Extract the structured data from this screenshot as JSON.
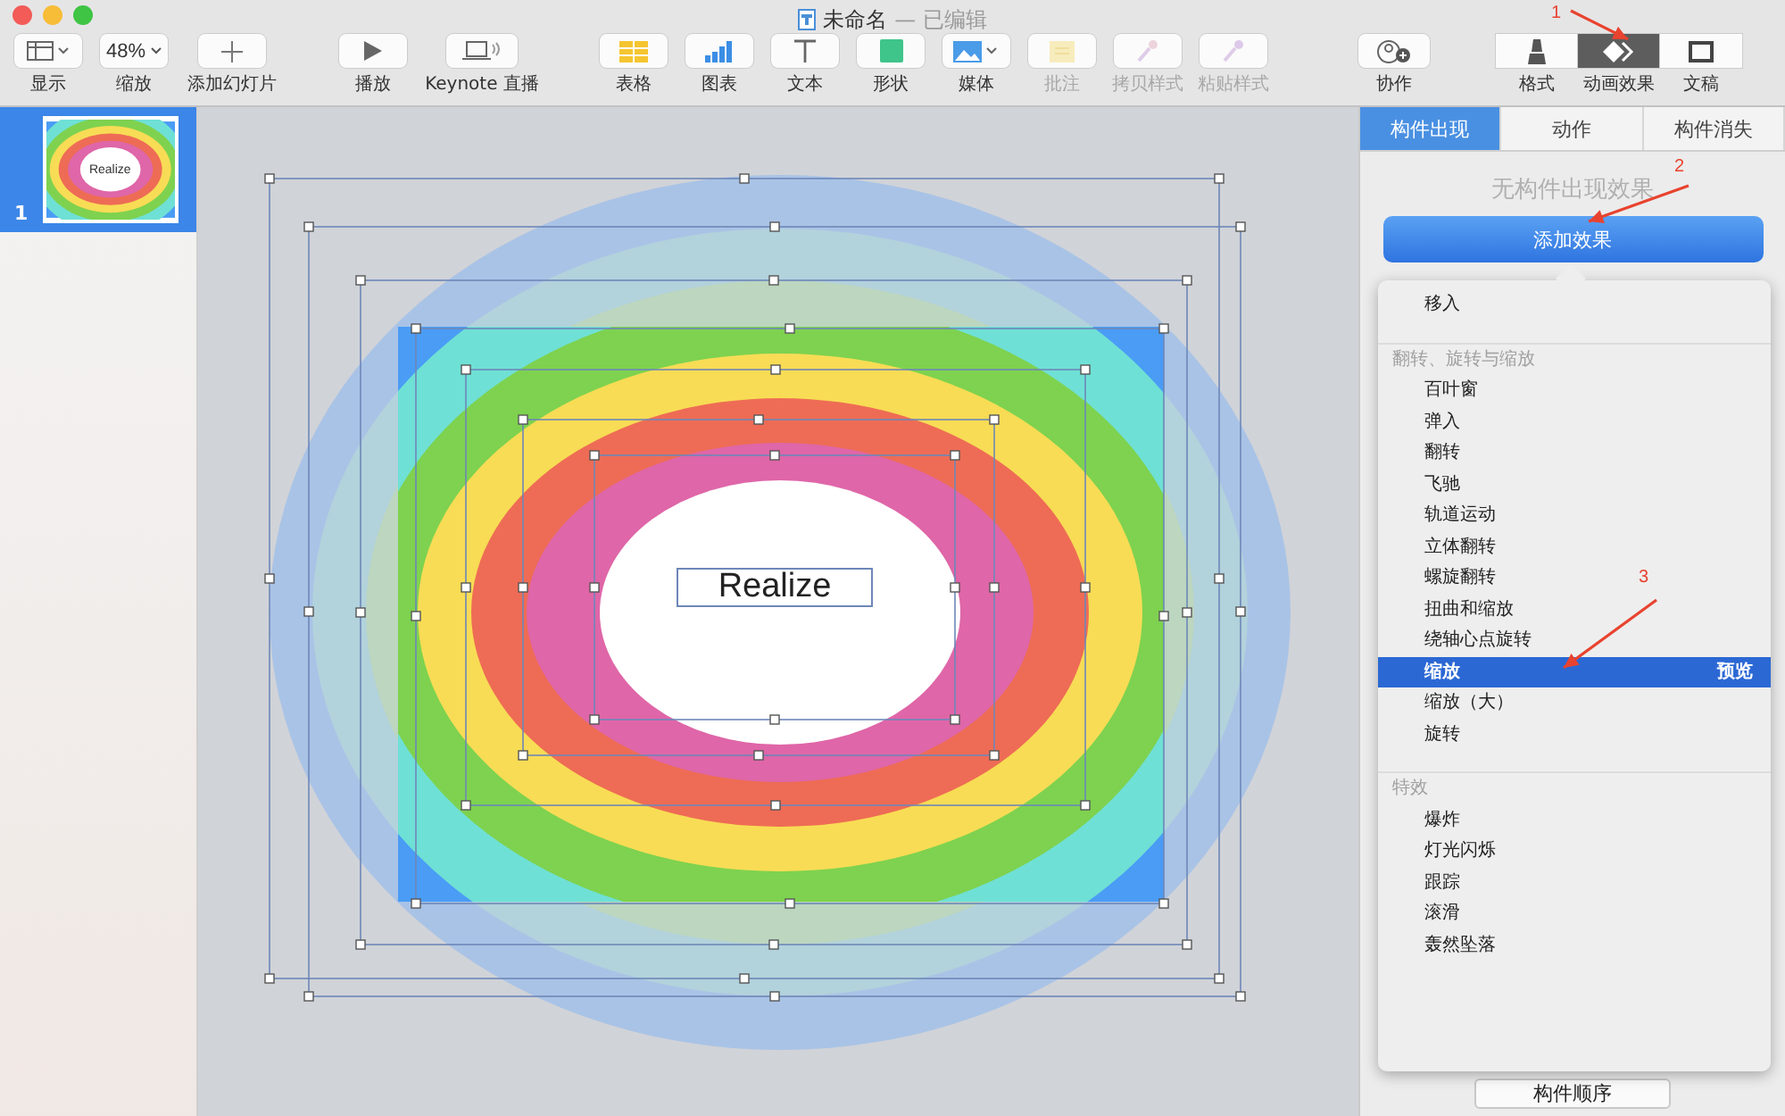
{
  "window": {
    "title": "未命名",
    "status": "— 已编辑"
  },
  "toolbar": {
    "groups": [
      {
        "items": [
          {
            "label": "显示",
            "disabled": false,
            "selected": false
          },
          {
            "value": "48%",
            "label": "缩放",
            "disabled": false,
            "selected": false
          },
          {
            "label": "添加幻灯片",
            "disabled": false,
            "selected": false
          }
        ]
      },
      {
        "items": [
          {
            "label": "播放",
            "disabled": false,
            "selected": false
          },
          {
            "label": "Keynote 直播",
            "disabled": false,
            "selected": false
          }
        ]
      },
      {
        "items": [
          {
            "label": "表格",
            "disabled": false,
            "selected": false
          },
          {
            "label": "图表",
            "disabled": false,
            "selected": false
          },
          {
            "label": "文本",
            "disabled": false,
            "selected": false
          },
          {
            "label": "形状",
            "disabled": false,
            "selected": false
          },
          {
            "label": "媒体",
            "disabled": false,
            "selected": false
          },
          {
            "label": "批注",
            "disabled": true,
            "selected": false
          },
          {
            "label": "拷贝样式",
            "disabled": true,
            "selected": false
          },
          {
            "label": "粘贴样式",
            "disabled": true,
            "selected": false
          }
        ]
      },
      {
        "items": [
          {
            "label": "协作",
            "disabled": false,
            "selected": false
          }
        ]
      },
      {
        "items": [
          {
            "label": "格式",
            "disabled": false,
            "selected": false
          },
          {
            "label": "动画效果",
            "disabled": false,
            "selected": true
          },
          {
            "label": "文稿",
            "disabled": false,
            "selected": false
          }
        ]
      }
    ]
  },
  "slides": [
    {
      "number": "1",
      "selected": true,
      "caption": "Realize"
    }
  ],
  "canvas": {
    "slide_text": "Realize"
  },
  "inspector": {
    "tabs": [
      {
        "label": "构件出现",
        "selected": true
      },
      {
        "label": "动作",
        "selected": false
      },
      {
        "label": "构件消失",
        "selected": false
      }
    ],
    "empty_message": "无构件出现效果",
    "add_button": "添加效果",
    "order_button": "构件顺序"
  },
  "menu": {
    "items": [
      {
        "kind": "item",
        "label": "移入",
        "selected": false
      },
      {
        "kind": "header",
        "label": "翻转、旋转与缩放"
      },
      {
        "kind": "item",
        "label": "百叶窗",
        "selected": false
      },
      {
        "kind": "item",
        "label": "弹入",
        "selected": false
      },
      {
        "kind": "item",
        "label": "翻转",
        "selected": false
      },
      {
        "kind": "item",
        "label": "飞驰",
        "selected": false
      },
      {
        "kind": "item",
        "label": "轨道运动",
        "selected": false
      },
      {
        "kind": "item",
        "label": "立体翻转",
        "selected": false
      },
      {
        "kind": "item",
        "label": "螺旋翻转",
        "selected": false
      },
      {
        "kind": "item",
        "label": "扭曲和缩放",
        "selected": false
      },
      {
        "kind": "item",
        "label": "绕轴心点旋转",
        "selected": false
      },
      {
        "kind": "item",
        "label": "缩放",
        "selected": true,
        "hint": "预览"
      },
      {
        "kind": "item",
        "label": "缩放（大）",
        "selected": false
      },
      {
        "kind": "item",
        "label": "旋转",
        "selected": false
      },
      {
        "kind": "header",
        "label": "特效"
      },
      {
        "kind": "item",
        "label": "爆炸",
        "selected": false
      },
      {
        "kind": "item",
        "label": "灯光闪烁",
        "selected": false
      },
      {
        "kind": "item",
        "label": "跟踪",
        "selected": false
      },
      {
        "kind": "item",
        "label": "滚滑",
        "selected": false
      },
      {
        "kind": "item",
        "label": "轰然坠落",
        "selected": false
      }
    ]
  },
  "annotations": [
    {
      "label": "1"
    },
    {
      "label": "2"
    },
    {
      "label": "3"
    }
  ]
}
